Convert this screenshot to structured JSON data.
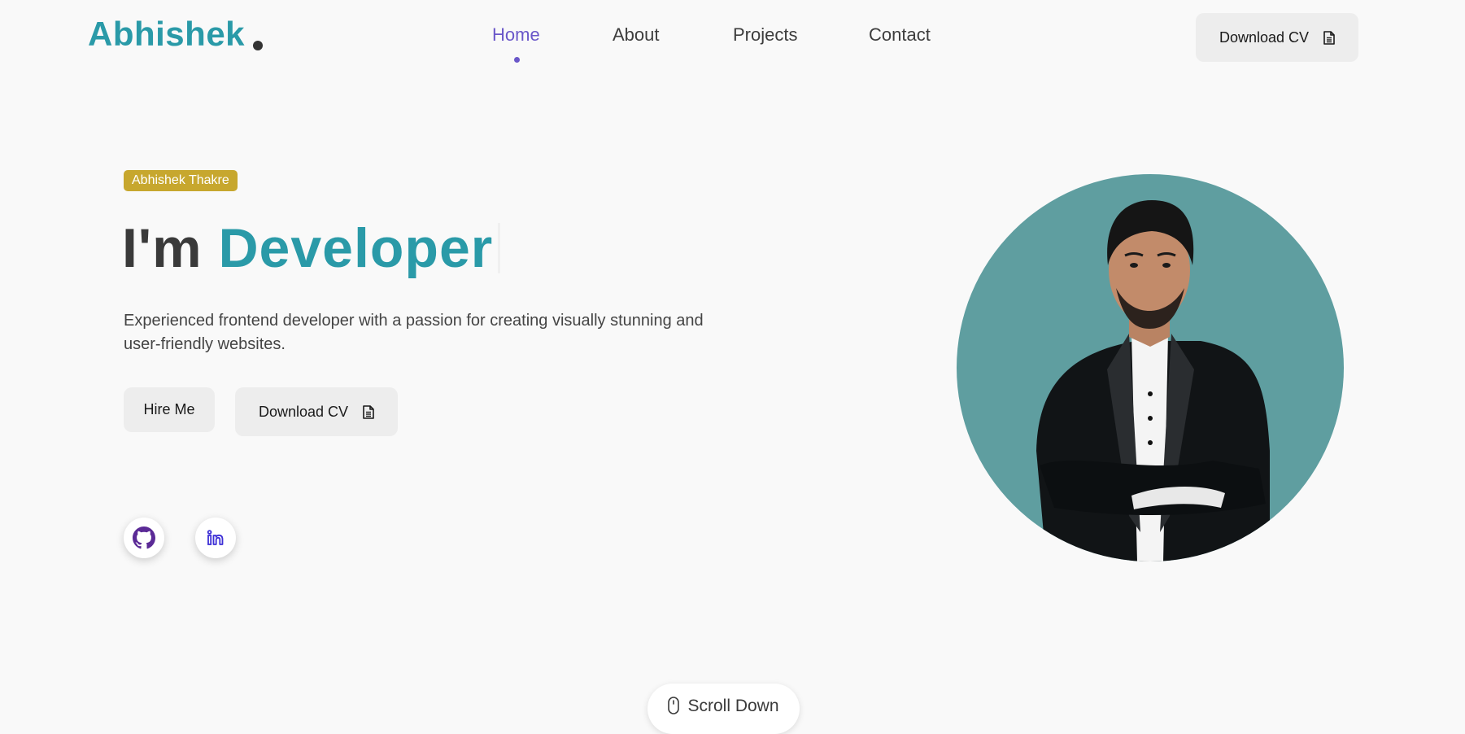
{
  "header": {
    "logo_text": "Abhishek",
    "nav": [
      {
        "label": "Home",
        "active": true
      },
      {
        "label": "About",
        "active": false
      },
      {
        "label": "Projects",
        "active": false
      },
      {
        "label": "Contact",
        "active": false
      }
    ],
    "download_cv_label": "Download CV",
    "download_cv_icon": "document-icon"
  },
  "hero": {
    "badge": "Abhishek Thakre",
    "headline_prefix": "I'm",
    "headline_accent": "Developer",
    "description": "Experienced frontend developer with a passion for creating visually stunning and user-friendly websites.",
    "hire_me_label": "Hire Me",
    "download_cv_label": "Download CV",
    "download_cv_icon": "document-icon",
    "social": [
      {
        "name": "github-icon",
        "color": "#5b2a96"
      },
      {
        "name": "linkedin-icon",
        "color": "#3d2fd6"
      }
    ],
    "portrait_background": "#5f9ea0"
  },
  "scroll_down": {
    "label": "Scroll Down",
    "icon": "mouse-icon"
  },
  "colors": {
    "brand": "#2a9aa8",
    "nav_active": "#6a57c9",
    "badge": "#c7a72e",
    "background": "#f9f9f9",
    "button": "#ededed"
  }
}
